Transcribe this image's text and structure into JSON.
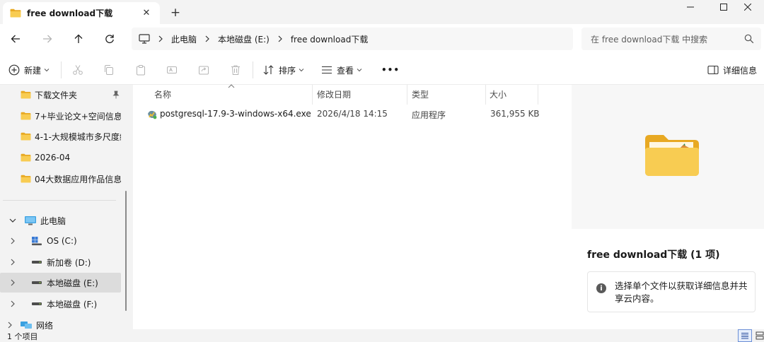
{
  "tab": {
    "title": "free download下载",
    "close_icon": "close-icon",
    "new_tab_icon": "plus-icon"
  },
  "window": {
    "minimize_icon": "minimize-icon",
    "maximize_icon": "maximize-icon",
    "close_icon": "close-icon"
  },
  "nav": {
    "back_icon": "arrow-left-icon",
    "forward_icon": "arrow-right-icon",
    "up_icon": "arrow-up-icon",
    "refresh_icon": "refresh-icon",
    "breadcrumb": [
      "此电脑",
      "本地磁盘 (E:)",
      "free download下载"
    ],
    "search_placeholder": "在 free download下载 中搜索"
  },
  "toolbar": {
    "new_label": "新建",
    "sort_label": "排序",
    "view_label": "查看",
    "more_label": "•••",
    "details_label": "详细信息"
  },
  "sidebar": {
    "quick_access": [
      {
        "label": "下载文件夹",
        "pinned": true
      },
      {
        "label": "7+毕业论文+空间信息与",
        "pinned": false
      },
      {
        "label": "4-1-大规模城市多尺度绿",
        "pinned": false
      },
      {
        "label": "2026-04",
        "pinned": false
      },
      {
        "label": "04大数据应用作品信息提",
        "pinned": false
      }
    ],
    "this_pc": "此电脑",
    "drives": [
      {
        "label": "OS (C:)",
        "icon": "os-drive-icon",
        "selected": false
      },
      {
        "label": "新加卷 (D:)",
        "icon": "drive-icon",
        "selected": false
      },
      {
        "label": "本地磁盘 (E:)",
        "icon": "drive-icon",
        "selected": true
      },
      {
        "label": "本地磁盘 (F:)",
        "icon": "drive-icon",
        "selected": false
      }
    ],
    "network": "网络"
  },
  "files": {
    "columns": [
      "名称",
      "修改日期",
      "类型",
      "大小"
    ],
    "rows": [
      {
        "name": "postgresql-17.9-3-windows-x64.exe",
        "date": "2026/4/18 14:15",
        "type": "应用程序",
        "size": "361,955 KB"
      }
    ]
  },
  "details": {
    "title": "free download下载 (1 项)",
    "info": "选择单个文件以获取详细信息并共享云内容。"
  },
  "status": {
    "count": "1 个项目"
  },
  "colors": {
    "folder": "#f6c542",
    "accent": "#0067c0",
    "selected": "#dcdcdc"
  }
}
